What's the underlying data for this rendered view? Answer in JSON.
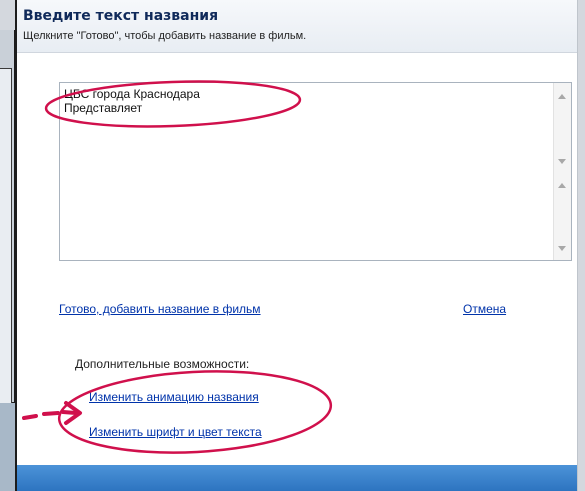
{
  "dialog": {
    "title": "Введите текст названия",
    "subtitle": "Щелкните \"Готово\", чтобы добавить название в фильм."
  },
  "title_text": {
    "line1": "ЦБС города Краснодара",
    "line2": "Представляет"
  },
  "actions": {
    "done_link": "Готово, добавить название в фильм",
    "cancel_link": "Отмена"
  },
  "more_options": {
    "label": "Дополнительные возможности:",
    "animation_link": "Изменить анимацию названия",
    "font_link": "Изменить шрифт и цвет текста"
  },
  "colors": {
    "link": "#0033aa",
    "title": "#102a5a",
    "annotation": "#d0104c",
    "bottom_bar": "#2d74c0"
  },
  "icons": [
    "scroll-up-arrow-icon",
    "scroll-down-arrow-icon",
    "red-arrow-icon"
  ]
}
